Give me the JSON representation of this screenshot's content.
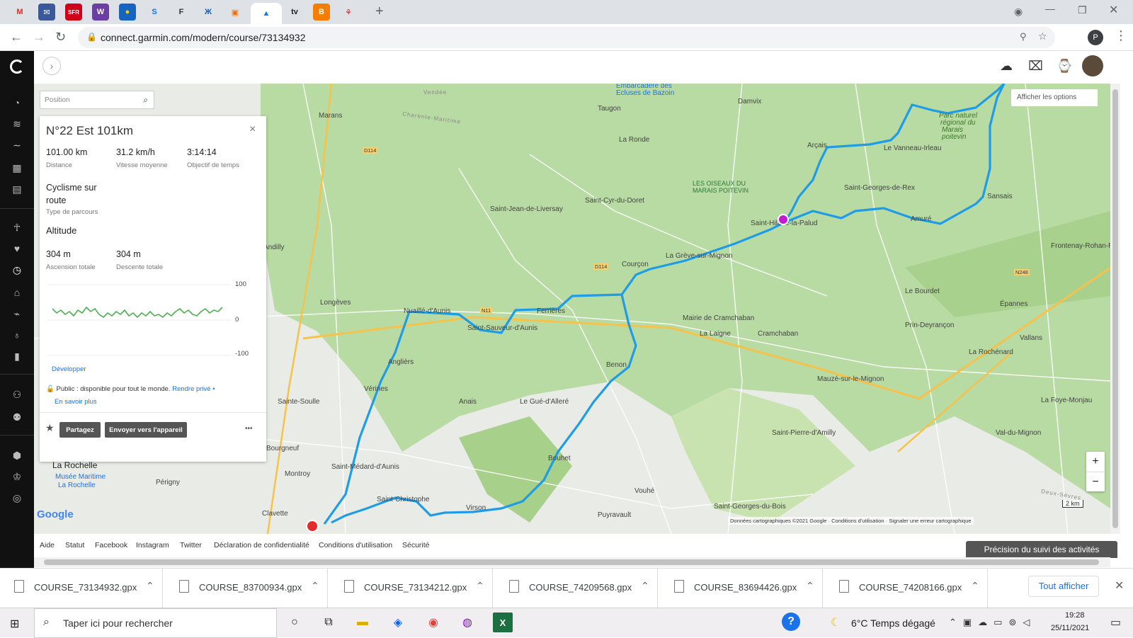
{
  "browser": {
    "url": "connect.garmin.com/modern/course/73134932",
    "tabs": [
      "M",
      "✉",
      "SFR",
      "W",
      "●",
      "S",
      "F",
      "Ж",
      "▣",
      "▲",
      "tv",
      "B",
      "⚘"
    ],
    "avatar_letter": "P"
  },
  "map": {
    "search_placeholder": "Position",
    "options_label": "Afficher les options",
    "attribution": "Données cartographiques ©2021 Google",
    "terms": "Conditions d'utilisation",
    "report": "Signaler une erreur cartographique",
    "scale": "2 km",
    "google": "Google",
    "zoom_in": "+",
    "zoom_out": "−",
    "places": [
      {
        "t": "Marans"
      },
      {
        "t": "Taugon"
      },
      {
        "t": "La Ronde"
      },
      {
        "t": "Damvix"
      },
      {
        "t": "Embarcadère des"
      },
      {
        "t": "Ecluses de Bazoin"
      },
      {
        "t": "Parc naturel"
      },
      {
        "t": "régional du"
      },
      {
        "t": "Marais"
      },
      {
        "t": "poitevin"
      },
      {
        "t": "Le Vanneau-Irleau"
      },
      {
        "t": "Arçais"
      },
      {
        "t": "Saint-Georges-de-Rex"
      },
      {
        "t": "Sansais"
      },
      {
        "t": "Amuré"
      },
      {
        "t": "LES OISEAUX DU"
      },
      {
        "t": "MARAIS POITEVIN"
      },
      {
        "t": "Saint-Cyr-du-Doret"
      },
      {
        "t": "Saint-Jean-de-Liversay"
      },
      {
        "t": "Saint-Hilaire-la-Palud"
      },
      {
        "t": "La Grève-sur-Mignon"
      },
      {
        "t": "Andilly"
      },
      {
        "t": "Courçon"
      },
      {
        "t": "Longèves"
      },
      {
        "t": "Nuaillé-d'Aunis"
      },
      {
        "t": "Ferrières"
      },
      {
        "t": "Saint-Sauveur-d'Aunis"
      },
      {
        "t": "Mairie de Cramchaban"
      },
      {
        "t": "La Laigne"
      },
      {
        "t": "Cramchaban"
      },
      {
        "t": "Le Bourdet"
      },
      {
        "t": "Prin-Deyrançon"
      },
      {
        "t": "Épannes"
      },
      {
        "t": "Vallans"
      },
      {
        "t": "Frontenay-Rohan-R"
      },
      {
        "t": "La Rochénard"
      },
      {
        "t": "Mauzé-sur-le-Mignon"
      },
      {
        "t": "Benon"
      },
      {
        "t": "Anglièrs"
      },
      {
        "t": "Vérines"
      },
      {
        "t": "Sainte-Soulle"
      },
      {
        "t": "Anais"
      },
      {
        "t": "Le Gué-d'Alleré"
      },
      {
        "t": "Bourgneuf"
      },
      {
        "t": "La Rochelle"
      },
      {
        "t": "Montroy"
      },
      {
        "t": "Saint-Médard-d'Aunis"
      },
      {
        "t": "Périgny"
      },
      {
        "t": "Bouhet"
      },
      {
        "t": "Vouhé"
      },
      {
        "t": "Saint-Pierre-d'Amilly"
      },
      {
        "t": "Val-du-Mignon"
      },
      {
        "t": "La Foye-Monjau"
      },
      {
        "t": "Saint-Christophe"
      },
      {
        "t": "Virson"
      },
      {
        "t": "Clavette"
      },
      {
        "t": "Puyravault"
      },
      {
        "t": "Saint-Georges-du-Bois"
      },
      {
        "t": "Musée Maritime"
      },
      {
        "t": "La Rochelle"
      },
      {
        "t": "Charente-Maritime"
      },
      {
        "t": "Deux-Sèvres"
      },
      {
        "t": "Vendée"
      },
      {
        "t": "Andilly-d'Aunis"
      }
    ]
  },
  "course": {
    "title": "N°22 Est 101km",
    "distance": "101.00 km",
    "distance_label": "Distance",
    "speed": "31.2 km/h",
    "speed_label": "Vitesse moyenne",
    "time": "3:14:14",
    "time_label": "Objectif de temps",
    "type": "Cyclisme sur route",
    "type_label": "Type de parcours",
    "altitude_title": "Altitude",
    "ascent": "304 m",
    "ascent_label": "Ascension totale",
    "descent": "304 m",
    "descent_label": "Descente totale",
    "y_ticks": [
      "100",
      "0",
      "-100"
    ],
    "expand": "Développer",
    "privacy": "Public : disponible pour tout le monde.",
    "make_private": "Rendre privé •",
    "learn_more": "En savoir plus",
    "share": "Partagez",
    "send": "Envoyer vers l'appareil",
    "more": "•••",
    "close": "×"
  },
  "footer": {
    "links": [
      "Aide",
      "Statut",
      "Facebook",
      "Instagram",
      "Twitter",
      "Déclaration de confidentialité",
      "Conditions d'utilisation",
      "Sécurité"
    ],
    "accuracy_button": "Précision du suivi des activités"
  },
  "downloads": {
    "files": [
      "COURSE_73134932.gpx",
      "COURSE_83700934.gpx",
      "COURSE_73134212.gpx",
      "COURSE_74209568.gpx",
      "COURSE_83694426.gpx",
      "COURSE_74208166.gpx"
    ],
    "show_all": "Tout afficher"
  },
  "taskbar": {
    "search": "Taper ici pour rechercher",
    "weather": "6°C  Temps dégagé",
    "time": "19:28",
    "date": "25/11/2021"
  }
}
